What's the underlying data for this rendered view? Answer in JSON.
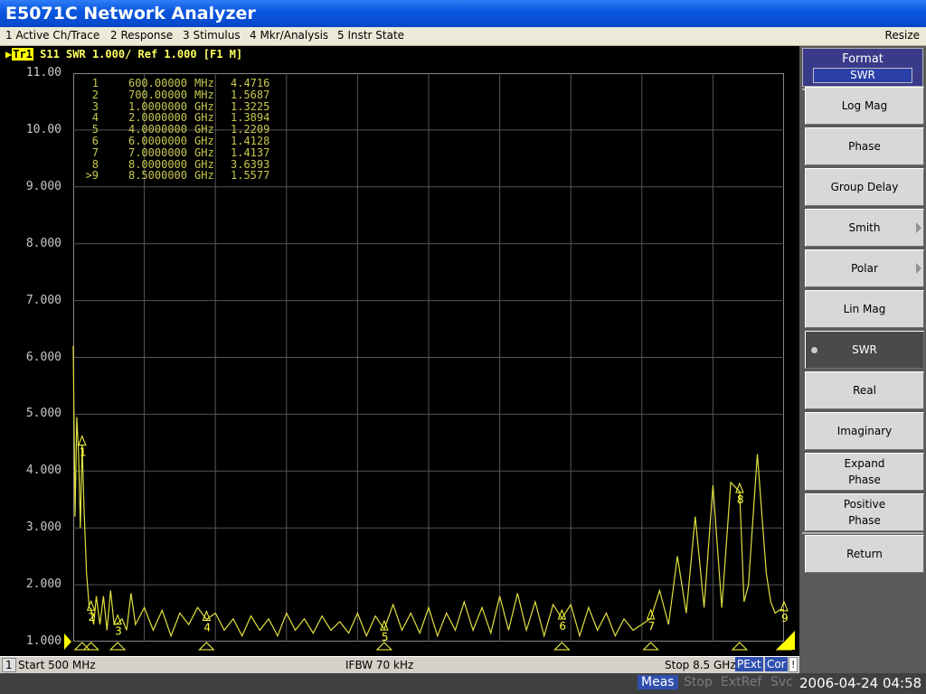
{
  "window": {
    "title": "E5071C Network Analyzer"
  },
  "menu": {
    "items": [
      "1 Active Ch/Trace",
      "2 Response",
      "3 Stimulus",
      "4 Mkr/Analysis",
      "5 Instr State"
    ],
    "resize": "Resize"
  },
  "trace_header": {
    "trace": "Tr1",
    "text": "S11  SWR 1.000/ Ref 1.000 [F1 M]"
  },
  "y_axis": {
    "labels": [
      "11.00",
      "10.00",
      "9.000",
      "8.000",
      "7.000",
      "6.000",
      "5.000",
      "4.000",
      "3.000",
      "2.000",
      "1.000"
    ]
  },
  "markers": [
    {
      "id": "1",
      "freq": "600.00000",
      "unit": "MHz",
      "value": "4.4716"
    },
    {
      "id": "2",
      "freq": "700.00000",
      "unit": "MHz",
      "value": "1.5687"
    },
    {
      "id": "3",
      "freq": "1.0000000",
      "unit": "GHz",
      "value": "1.3225"
    },
    {
      "id": "4",
      "freq": "2.0000000",
      "unit": "GHz",
      "value": "1.3894"
    },
    {
      "id": "5",
      "freq": "4.0000000",
      "unit": "GHz",
      "value": "1.2209"
    },
    {
      "id": "6",
      "freq": "6.0000000",
      "unit": "GHz",
      "value": "1.4128"
    },
    {
      "id": "7",
      "freq": "7.0000000",
      "unit": "GHz",
      "value": "1.4137"
    },
    {
      "id": "8",
      "freq": "8.0000000",
      "unit": "GHz",
      "value": "3.6393"
    },
    {
      "id": ">9",
      "freq": "8.5000000",
      "unit": "GHz",
      "value": "1.5577"
    }
  ],
  "chart_data": {
    "type": "line",
    "x_unit": "GHz",
    "ylim": [
      1,
      11
    ],
    "xlim": [
      0.5,
      8.5
    ],
    "series": [
      {
        "x": [
          0.5,
          0.52,
          0.54,
          0.56,
          0.58,
          0.6,
          0.62,
          0.65,
          0.68,
          0.7,
          0.73,
          0.76,
          0.8,
          0.84,
          0.88,
          0.92,
          0.96,
          1.0,
          1.05,
          1.1,
          1.15,
          1.2,
          1.3,
          1.4,
          1.5,
          1.6,
          1.7,
          1.8,
          1.9,
          2.0,
          2.1,
          2.2,
          2.3,
          2.4,
          2.5,
          2.6,
          2.7,
          2.8,
          2.9,
          3.0,
          3.1,
          3.2,
          3.3,
          3.4,
          3.5,
          3.6,
          3.7,
          3.8,
          3.9,
          4.0,
          4.1,
          4.2,
          4.3,
          4.4,
          4.5,
          4.6,
          4.7,
          4.8,
          4.9,
          5.0,
          5.1,
          5.2,
          5.3,
          5.4,
          5.5,
          5.6,
          5.7,
          5.8,
          5.9,
          6.0,
          6.1,
          6.2,
          6.3,
          6.4,
          6.5,
          6.6,
          6.7,
          6.8,
          6.9,
          7.0,
          7.1,
          7.2,
          7.3,
          7.4,
          7.5,
          7.6,
          7.7,
          7.8,
          7.9,
          8.0,
          8.05,
          8.1,
          8.2,
          8.3,
          8.35,
          8.4,
          8.45,
          8.5
        ],
        "y": [
          6.2,
          3.2,
          4.95,
          4.3,
          3.0,
          4.47,
          3.4,
          2.2,
          1.6,
          1.57,
          1.3,
          1.8,
          1.3,
          1.8,
          1.2,
          1.9,
          1.3,
          1.32,
          1.4,
          1.2,
          1.85,
          1.3,
          1.6,
          1.2,
          1.55,
          1.1,
          1.5,
          1.3,
          1.6,
          1.39,
          1.5,
          1.2,
          1.4,
          1.1,
          1.45,
          1.2,
          1.4,
          1.1,
          1.5,
          1.2,
          1.4,
          1.15,
          1.45,
          1.2,
          1.35,
          1.15,
          1.5,
          1.1,
          1.45,
          1.22,
          1.65,
          1.2,
          1.5,
          1.15,
          1.6,
          1.1,
          1.5,
          1.2,
          1.7,
          1.2,
          1.6,
          1.15,
          1.8,
          1.2,
          1.85,
          1.2,
          1.7,
          1.1,
          1.65,
          1.41,
          1.65,
          1.1,
          1.6,
          1.2,
          1.5,
          1.1,
          1.4,
          1.2,
          1.3,
          1.41,
          1.9,
          1.3,
          2.5,
          1.5,
          3.2,
          1.6,
          3.75,
          1.6,
          3.8,
          3.64,
          1.7,
          2.0,
          4.3,
          2.2,
          1.7,
          1.5,
          1.56,
          1.56
        ]
      }
    ],
    "marker_x": [
      0.6,
      0.7,
      1.0,
      2.0,
      4.0,
      6.0,
      7.0,
      8.0,
      8.5
    ]
  },
  "statusbar": {
    "channel": "1",
    "start": "Start 500 MHz",
    "ifbw": "IFBW 70 kHz",
    "stop": "Stop 8.5 GHz",
    "pext": "PExt",
    "cor": "Cor",
    "bang": "!"
  },
  "bottom": {
    "meas": "Meas",
    "stop": "Stop",
    "extref": "ExtRef",
    "svc": "Svc",
    "datetime": "2006-04-24 04:58"
  },
  "softkeys": {
    "header": "Format",
    "current": "SWR",
    "buttons": [
      {
        "label": "Log Mag"
      },
      {
        "label": "Phase"
      },
      {
        "label": "Group Delay"
      },
      {
        "label": "Smith"
      },
      {
        "label": "Polar"
      },
      {
        "label": "Lin Mag"
      },
      {
        "label": "SWR"
      },
      {
        "label": "Real"
      },
      {
        "label": "Imaginary"
      },
      {
        "label": "Expand\nPhase"
      },
      {
        "label": "Positive\nPhase"
      },
      {
        "label": "Return"
      }
    ]
  }
}
